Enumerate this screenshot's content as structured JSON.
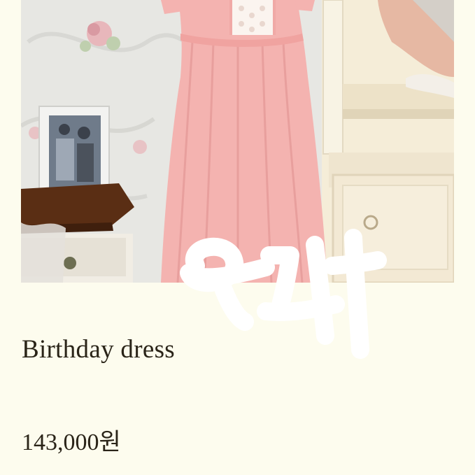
{
  "product": {
    "title": "Birthday dress",
    "price": "143,000원"
  },
  "colors": {
    "background": "#fdfcee",
    "text": "#2a2418",
    "dress": "#f4b3b0"
  }
}
